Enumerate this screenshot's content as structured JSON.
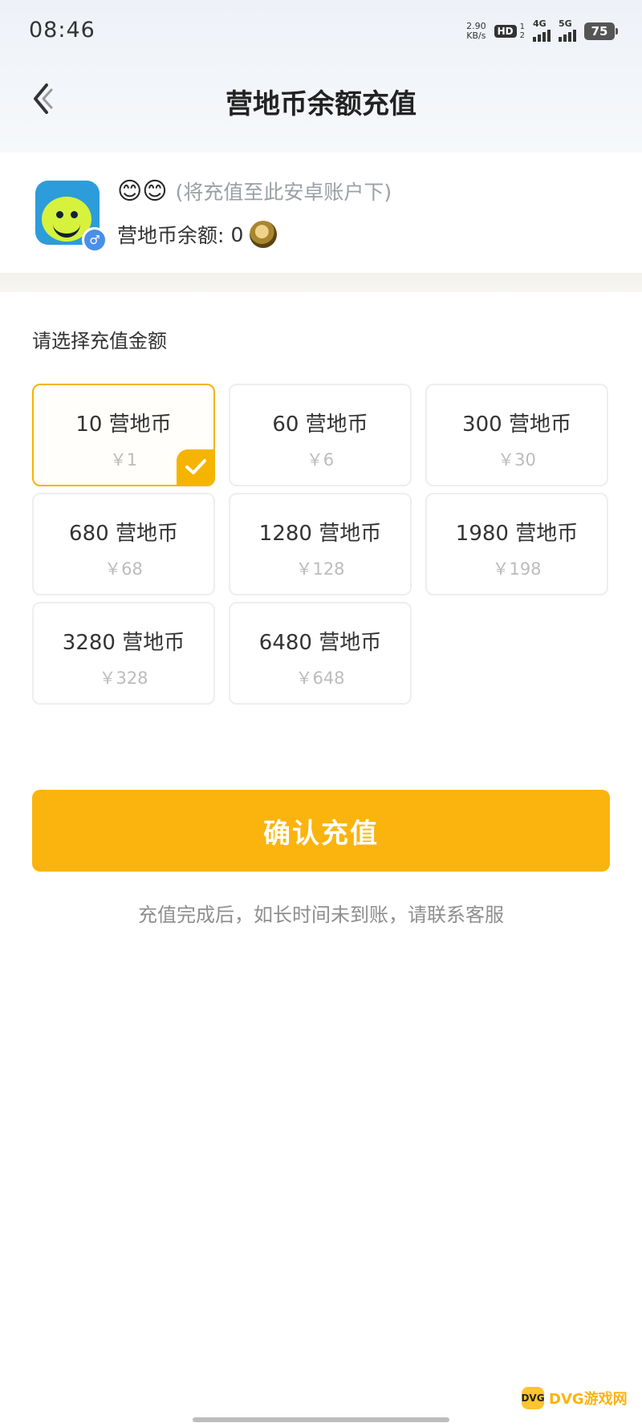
{
  "status_bar": {
    "time": "08:46",
    "net_speed_value": "2.90",
    "net_speed_unit": "KB/s",
    "hd_label": "HD",
    "hd_sub_top": "1",
    "hd_sub_bottom": "2",
    "network1": "4G",
    "network2": "5G",
    "battery": "75"
  },
  "nav": {
    "back_icon": "chevron-left-icon",
    "title": "营地币余额充值"
  },
  "account": {
    "avatar_icon": "smiley-avatar",
    "gender_symbol": "♂",
    "username": "😊😊",
    "note": "(将充值至此安卓账户下)",
    "balance_label": "营地币余额:",
    "balance_value": "0",
    "coin_icon": "coin-icon"
  },
  "recharge": {
    "section_label": "请选择充值金额",
    "selected_index": 0,
    "options": [
      {
        "amount": "10 营地币",
        "price": "￥1"
      },
      {
        "amount": "60 营地币",
        "price": "￥6"
      },
      {
        "amount": "300 营地币",
        "price": "￥30"
      },
      {
        "amount": "680 营地币",
        "price": "￥68"
      },
      {
        "amount": "1280 营地币",
        "price": "￥128"
      },
      {
        "amount": "1980 营地币",
        "price": "￥198"
      },
      {
        "amount": "3280 营地币",
        "price": "￥328"
      },
      {
        "amount": "6480 营地币",
        "price": "￥648"
      }
    ],
    "confirm_label": "确认充值",
    "footnote": "充值完成后，如长时间未到账，请联系客服"
  },
  "watermark": {
    "logo": "DVG",
    "text": "DVG游戏网"
  },
  "colors": {
    "accent": "#fbb40d",
    "selected_border": "#f5b400",
    "price_text": "#bcbcbc"
  }
}
